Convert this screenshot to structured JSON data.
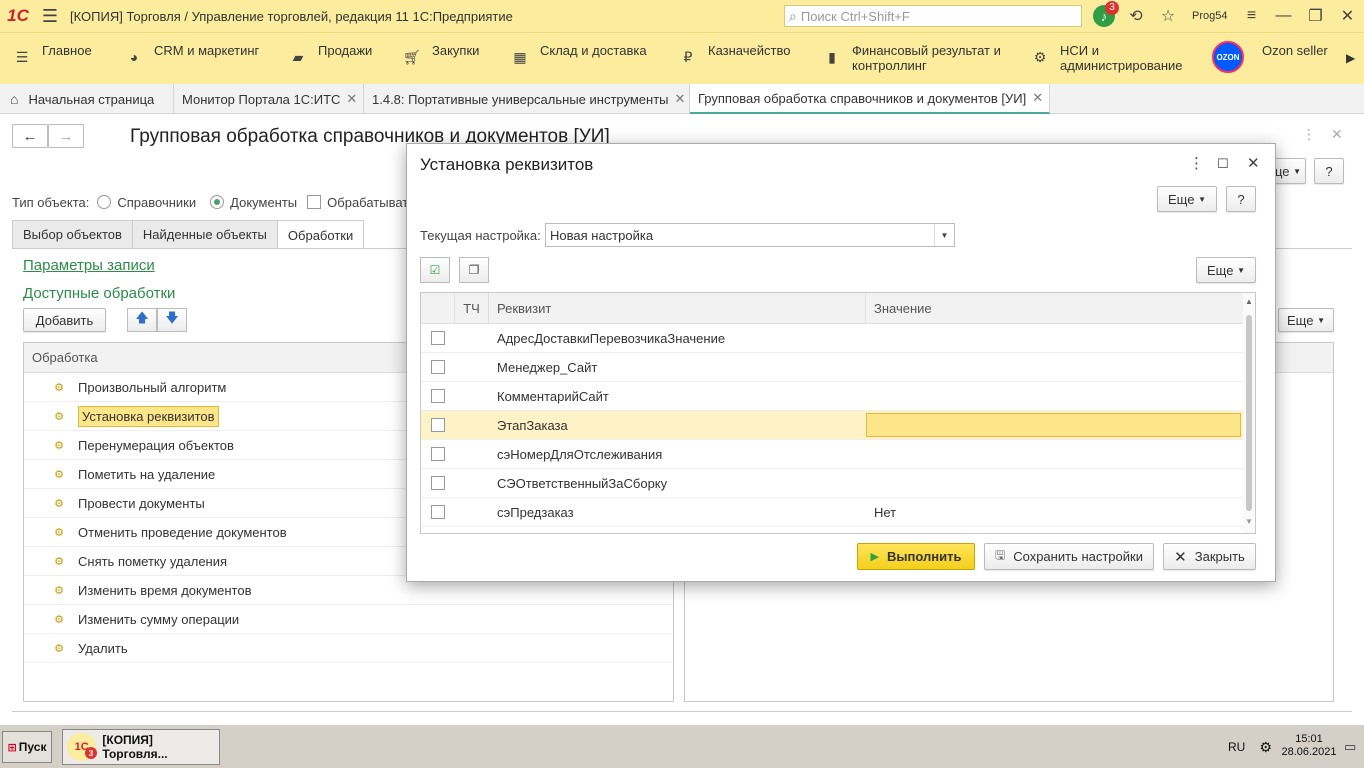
{
  "app": {
    "logo": "1С",
    "title": "[КОПИЯ] Торговля / Управление торговлей, редакция 11 1С:Предприятие",
    "search_placeholder": "Поиск Ctrl+Shift+F",
    "notifications_count": "3",
    "user": "Prog54"
  },
  "sections": [
    {
      "label": "Главное",
      "icon": "hamburger-icon"
    },
    {
      "label": "CRM и маркетинг",
      "icon": "pie-chart-icon"
    },
    {
      "label": "Продажи",
      "icon": "shopping-bag-icon"
    },
    {
      "label": "Закупки",
      "icon": "cart-icon"
    },
    {
      "label": "Склад и доставка",
      "icon": "warehouse-icon"
    },
    {
      "label": "Казначейство",
      "icon": "ruble-icon"
    },
    {
      "label": "Финансовый результат и контроллинг",
      "icon": "bar-chart-icon"
    },
    {
      "label": "НСИ и администрирование",
      "icon": "gear-icon"
    },
    {
      "label": "Ozon seller",
      "icon": "ozon-logo",
      "logo_text": "OZON"
    }
  ],
  "open_tabs": [
    {
      "label": "Начальная страница"
    },
    {
      "label": "Монитор Портала 1С:ИТС"
    },
    {
      "label": "1.4.8: Портативные универсальные инструменты"
    },
    {
      "label": "Групповая обработка справочников и документов [УИ]"
    }
  ],
  "main_form": {
    "title": "Групповая обработка справочников и документов [УИ]",
    "object_type_label": "Тип объекта:",
    "radio_catalogs": "Справочники",
    "radio_documents": "Документы",
    "checkbox_process": "Обрабатывать",
    "tabs": [
      "Выбор объектов",
      "Найденные объекты",
      "Обработки"
    ],
    "write_params_link": "Параметры записи",
    "available_processing": "Доступные обработки",
    "add_button": "Добавить",
    "more_button": "Еще",
    "partial_more": "це",
    "help": "?",
    "list_header": "Обработка",
    "items": [
      "Произвольный алгоритм",
      "Установка реквизитов",
      "Перенумерация объектов",
      "Пометить на удаление",
      "Провести документы",
      "Отменить проведение документов",
      "Снять пометку удаления",
      "Изменить время документов",
      "Изменить сумму операции",
      "Удалить"
    ]
  },
  "modal": {
    "title": "Установка реквизитов",
    "more_button": "Еще",
    "help": "?",
    "current_setting_label": "Текущая настройка:",
    "current_setting_value": "Новая настройка",
    "grid_more": "Еще",
    "columns": {
      "tc": "ТЧ",
      "attr": "Реквизит",
      "value": "Значение"
    },
    "rows": [
      {
        "attr": "АдресДоставкиПеревозчикаЗначение",
        "value": ""
      },
      {
        "attr": "Менеджер_Сайт",
        "value": ""
      },
      {
        "attr": "КомментарийСайт",
        "value": ""
      },
      {
        "attr": "ЭтапЗаказа",
        "value": ""
      },
      {
        "attr": "сэНомерДляОтслеживания",
        "value": ""
      },
      {
        "attr": "СЭОтветственныйЗаСборку",
        "value": ""
      },
      {
        "attr": "сэПредзаказ",
        "value": "Нет"
      }
    ],
    "execute_button": "Выполнить",
    "save_button": "Сохранить настройки",
    "close_button": "Закрыть"
  },
  "taskbar": {
    "start": "Пуск",
    "task_label": "[КОПИЯ] Торговля...",
    "task_logo": "1С",
    "task_badge": "3",
    "lang": "RU",
    "time": "15:01",
    "date": "28.06.2021"
  },
  "colors": {
    "accent_yellow": "#fbec9e",
    "link_green": "#2f8a4a",
    "selection": "#fde68a",
    "execute_button": "#f4cf1a"
  }
}
